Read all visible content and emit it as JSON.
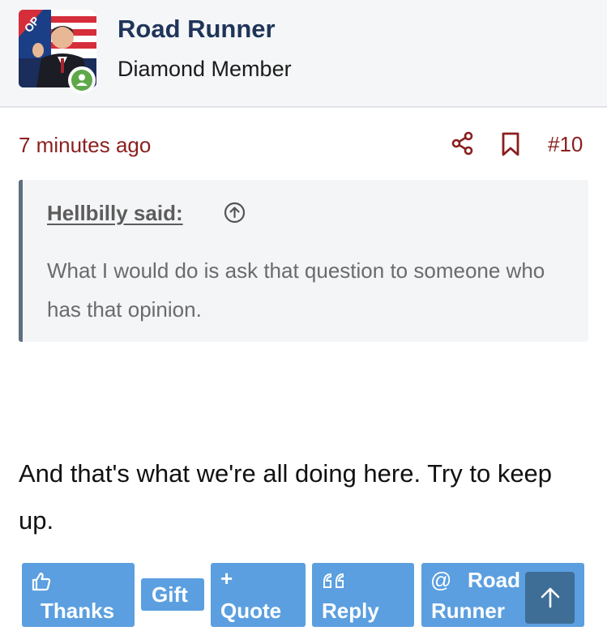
{
  "user": {
    "name": "Road Runner",
    "title": "Diamond Member",
    "avatar_badge": "OP",
    "status": "online",
    "avatar_icon": "avatar-photo",
    "online_icon": "person-online-icon"
  },
  "post": {
    "time": "7 minutes ago",
    "number": "#10",
    "share_icon": "share-icon",
    "bookmark_icon": "bookmark-icon",
    "quote": {
      "author": "Hellbilly said:",
      "text": "What I would do is ask that question to someone who has that opinion.",
      "jump_icon": "arrow-up-circle-icon"
    },
    "body": "And that's what we're all doing here. Try to keep up."
  },
  "actions": {
    "thanks": "Thanks",
    "gift": "Gift",
    "quote": "Quote",
    "reply": "Reply",
    "mention_line1": "Road",
    "mention_line2": "Runner",
    "mention_symbol": "@",
    "quote_symbol": "+",
    "icons": [
      "thumbs-up-icon",
      "plus-icon",
      "quote-marks-icon",
      "at-icon",
      "arrow-up-icon"
    ]
  },
  "colors": {
    "accent_red": "#8b1f1f",
    "username_blue": "#1f3458",
    "button_blue": "#5b9fe0",
    "scroll_button": "#3e6d96",
    "online_green": "#5fa84a"
  }
}
